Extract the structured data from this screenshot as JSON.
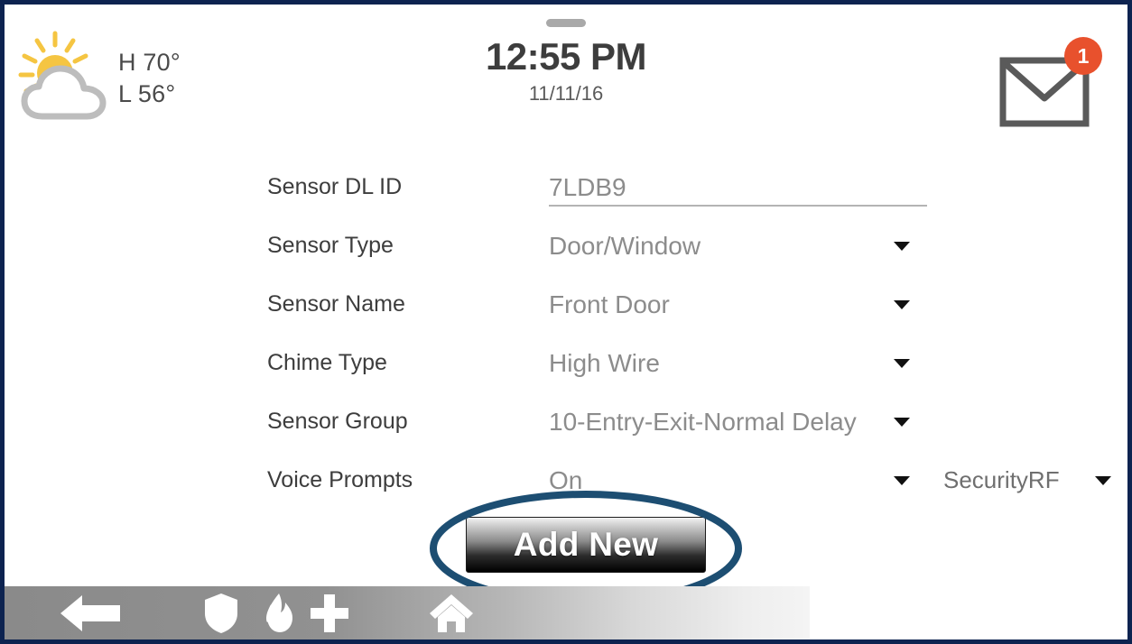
{
  "header": {
    "weather": {
      "icon": "sun-behind-cloud-icon",
      "high": "H 70°",
      "low": "L 56°",
      "sun_color": "#f5c542",
      "cloud_outline_color": "#bdbdbd"
    },
    "clock": {
      "time": "12:55 PM",
      "date": "11/11/16",
      "handle": "drawer-handle"
    },
    "messages": {
      "icon": "envelope-icon",
      "badge_count": "1",
      "badge_color": "#e8512d"
    }
  },
  "form": {
    "rows": [
      {
        "label": "Sensor DL ID",
        "value": "7LDB9",
        "control": "text-input",
        "caret": false,
        "underline": true
      },
      {
        "label": "Sensor Type",
        "value": "Door/Window",
        "control": "dropdown",
        "caret": true,
        "underline": false
      },
      {
        "label": "Sensor Name",
        "value": "Front Door",
        "control": "dropdown",
        "caret": true,
        "underline": false
      },
      {
        "label": "Chime Type",
        "value": "High Wire",
        "control": "dropdown",
        "caret": true,
        "underline": false
      },
      {
        "label": "Sensor Group",
        "value": "10-Entry-Exit-Normal Delay",
        "control": "dropdown",
        "caret": true,
        "underline": false
      },
      {
        "label": "Voice Prompts",
        "value": "On",
        "control": "dropdown",
        "caret": true,
        "underline": false,
        "secondary_value": "SecurityRF",
        "secondary_control": "dropdown"
      }
    ]
  },
  "actions": {
    "add_new_label": "Add New"
  },
  "annotation": {
    "shape": "ellipse-highlight",
    "color": "#1d4e72",
    "target": "add-new-button"
  },
  "toolbar": {
    "items": [
      {
        "icon": "back-arrow-icon",
        "name": "back-button"
      },
      {
        "icon": "shield-icon",
        "name": "police-panic-button"
      },
      {
        "icon": "flame-icon",
        "name": "fire-panic-button"
      },
      {
        "icon": "medical-cross-icon",
        "name": "medical-panic-button"
      },
      {
        "icon": "home-icon",
        "name": "home-button"
      }
    ],
    "icon_color": "#ffffff"
  },
  "theme": {
    "page_border": "#0d2350",
    "label_color": "#3d3d3d",
    "value_color": "#8c8c8c",
    "background": "#ffffff"
  }
}
